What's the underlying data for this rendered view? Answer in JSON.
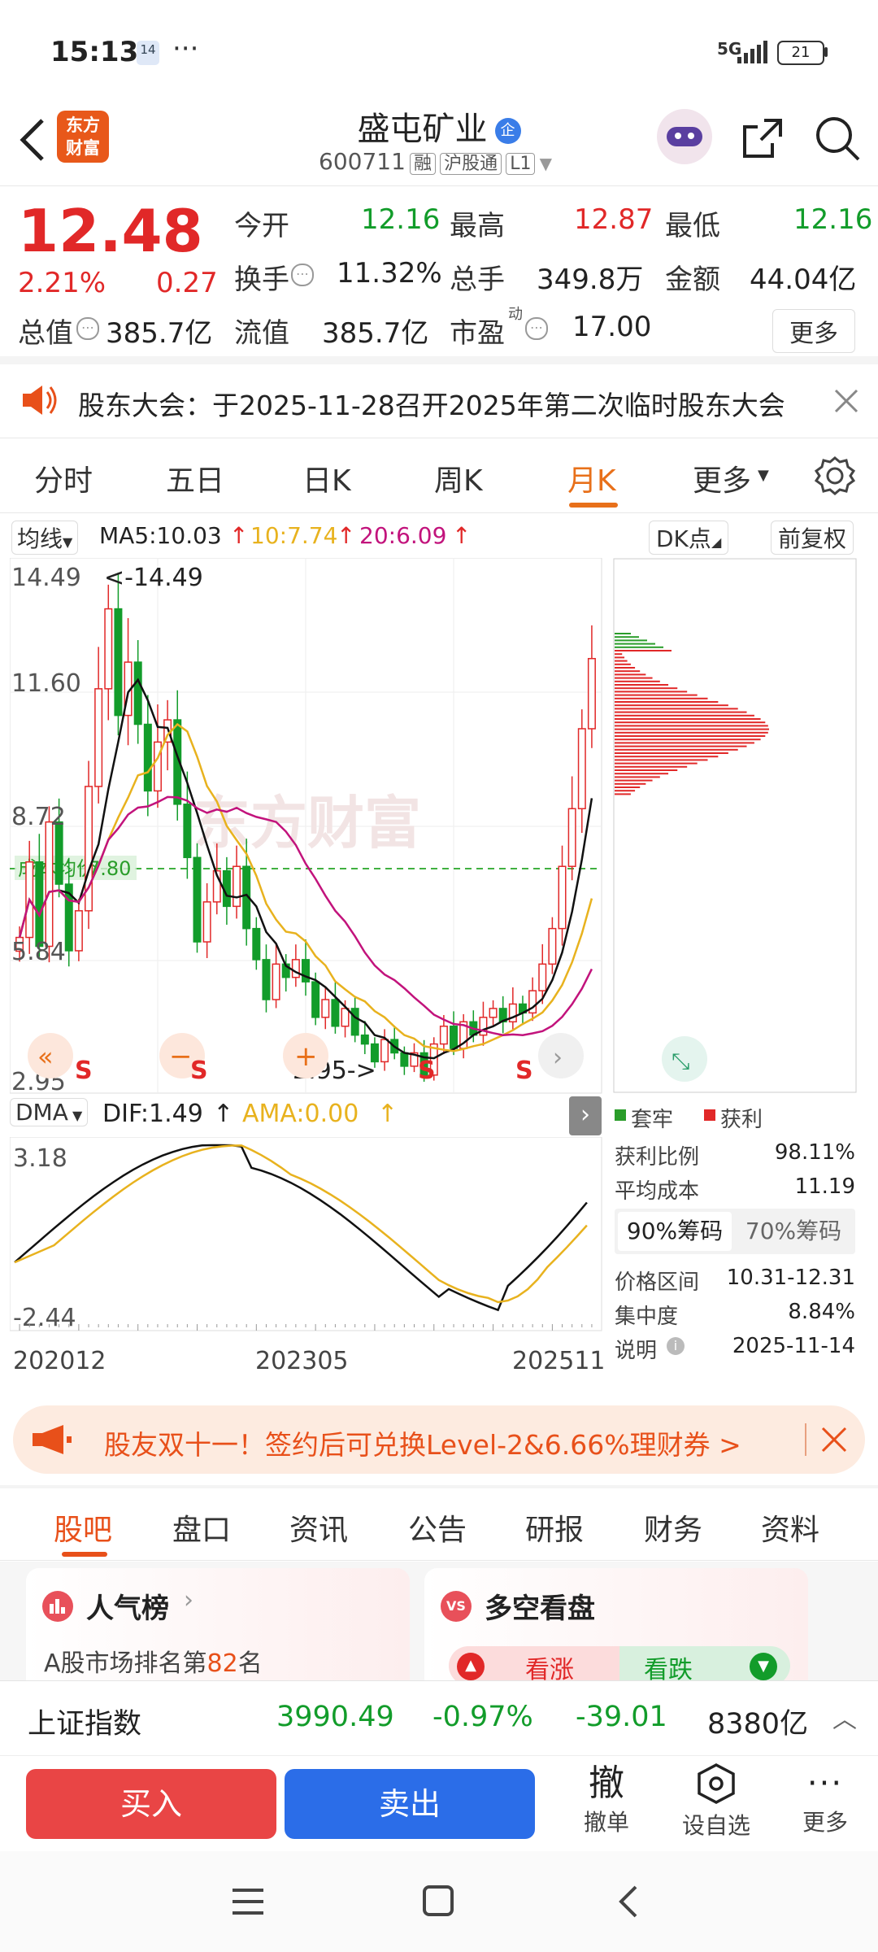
{
  "status_bar": {
    "time": "15:13",
    "notif_badge": "14",
    "dots": "···",
    "signal": "5G",
    "battery": "21"
  },
  "header": {
    "logo_text": "东方\n财富",
    "stock_name": "盛屯矿业",
    "verified_badge": "企",
    "code": "600711",
    "tags": [
      "融",
      "沪股通",
      "L1"
    ]
  },
  "quote": {
    "price": "12.48",
    "change_pct": "2.21%",
    "change_amt": "0.27",
    "open_label": "今开",
    "open": "12.16",
    "high_label": "最高",
    "high": "12.87",
    "low_label": "最低",
    "low": "12.16",
    "turnover_label": "换手",
    "turnover": "11.32%",
    "volume_label": "总手",
    "volume": "349.8万",
    "amount_label": "金额",
    "amount": "44.04亿",
    "mktcap_label": "总值",
    "mktcap": "385.7亿",
    "float_label": "流值",
    "float": "385.7亿",
    "pe_label": "市盈",
    "pe_sup": "动",
    "pe": "17.00",
    "more_button": "更多"
  },
  "notice": {
    "text": "股东大会：于2025-11-28召开2025年第二次临时股东大会"
  },
  "chart_tabs": {
    "items": [
      "分时",
      "五日",
      "日K",
      "周K",
      "月K",
      "更多"
    ],
    "active_index": 4
  },
  "indicator_bar": {
    "ma_select": "均线",
    "ma5": "MA5:10.03",
    "ma10": "10:7.74",
    "ma20": "20:6.09",
    "dk_button": "DK点",
    "adjust_button": "前复权"
  },
  "kline": {
    "y_labels": [
      "14.49",
      "11.60",
      "8.72",
      "5.84",
      "2.95"
    ],
    "max_marker": "<-14.49",
    "min_marker": "2.95->",
    "cost_label": "成本均价",
    "cost_value": "7.80",
    "s_marks": [
      "S",
      "S",
      "S",
      "S"
    ],
    "watermark": "东方财富"
  },
  "dma": {
    "select": "DMA",
    "dif": "DIF:1.49",
    "ama": "AMA:0.00",
    "y_top": "3.18",
    "y_bottom": "-2.44",
    "x_labels": [
      "202012",
      "202305",
      "202511"
    ]
  },
  "chip_panel": {
    "legend_trapped": "套牢",
    "legend_profit": "获利",
    "profit_ratio_label": "获利比例",
    "profit_ratio": "98.11%",
    "avg_cost_label": "平均成本",
    "avg_cost": "11.19",
    "tab_90": "90%筹码",
    "tab_70": "70%筹码",
    "range_label": "价格区间",
    "range": "10.31-12.31",
    "concentration_label": "集中度",
    "concentration": "8.84%",
    "note_label": "说明",
    "note_date": "2025-11-14"
  },
  "promo": {
    "text": "股友双十一！签约后可兑换Level-2&6.66%理财券 >"
  },
  "section_tabs": {
    "items": [
      "股吧",
      "盘口",
      "资讯",
      "公告",
      "研报",
      "财务",
      "资料"
    ],
    "active_index": 0
  },
  "cards": {
    "popularity_title": "人气榜",
    "popularity_text_prefix": "A股市场排名第",
    "popularity_rank": "82",
    "popularity_text_suffix": "名",
    "duokong_title": "多空看盘",
    "bull": "看涨",
    "bear": "看跌"
  },
  "index_bar": {
    "name": "上证指数",
    "value": "3990.49",
    "pct": "-0.97%",
    "change": "-39.01",
    "amount": "8380亿"
  },
  "actions": {
    "buy": "买入",
    "sell": "卖出",
    "cancel_icon": "撤",
    "cancel": "撤单",
    "set_watch": "设自选",
    "more": "更多"
  },
  "colors": {
    "up": "#e12828",
    "down": "#129c2a",
    "accent": "#e8701a",
    "ma10": "#e8b21e",
    "ma20": "#c2137c",
    "sell_blue": "#2b6de8"
  },
  "chart_data": {
    "type": "candlestick",
    "period": "monthly",
    "x_labels": [
      "202012",
      "202305",
      "202511"
    ],
    "price_range": [
      2.95,
      14.49
    ],
    "highest": 14.49,
    "lowest": 2.95,
    "last_close": 12.48,
    "ma": {
      "MA5": 10.03,
      "MA10": 7.74,
      "MA20": 6.09
    },
    "dma": {
      "DIF": 1.49,
      "AMA": 0.0,
      "range": [
        -2.44,
        3.18
      ]
    }
  }
}
